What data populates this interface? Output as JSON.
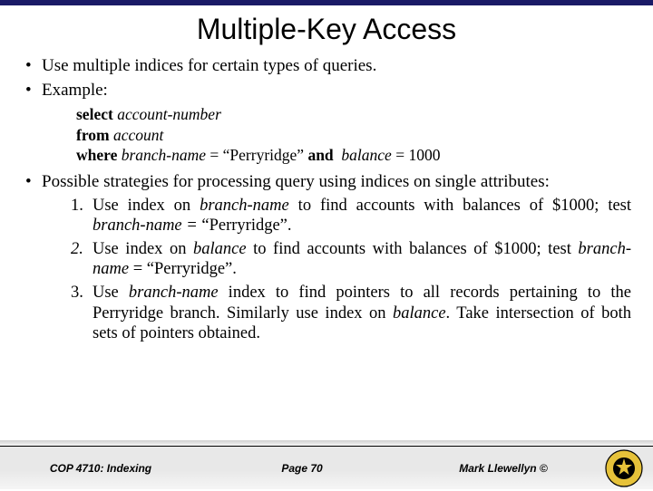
{
  "title": "Multiple-Key Access",
  "bullets": {
    "b1": "Use multiple indices for certain types of queries.",
    "b2": "Example:",
    "b3_pre": "Possible strategies for processing query using indices on single attributes:"
  },
  "code": {
    "select_kw": "select",
    "select_arg": " account-number",
    "from_kw": "from",
    "from_arg": " account",
    "where_kw": "where",
    "where_lhs": " branch-name",
    "where_eq": " = “Perryridge” ",
    "and_kw": "and",
    "where_rhs1": "  balance",
    "where_rhs2": " = 1000"
  },
  "strategies": {
    "n1": "1.",
    "s1a": " Use index on ",
    "s1b": "branch-name",
    "s1c": " to find accounts with balances of $1000; test ",
    "s1d": "branch-name = ",
    "s1e": " “Perryridge”.",
    "n2": "2.",
    "s2a": " Use index on ",
    "s2b": "balance",
    "s2c": " to find accounts with balances of $1000; test ",
    "s2d": "branch-name",
    "s2e": " = “Perryridge”.",
    "n3": "3.",
    "s3a": " Use ",
    "s3b": "branch-name",
    "s3c": " index to find pointers to all records pertaining to the Perryridge branch.  Similarly use index on ",
    "s3d": "balance",
    "s3e": ".  Take intersection of both sets of pointers obtained."
  },
  "footer": {
    "course": "COP 4710: Indexing",
    "page": "Page 70",
    "author": "Mark Llewellyn ©"
  }
}
